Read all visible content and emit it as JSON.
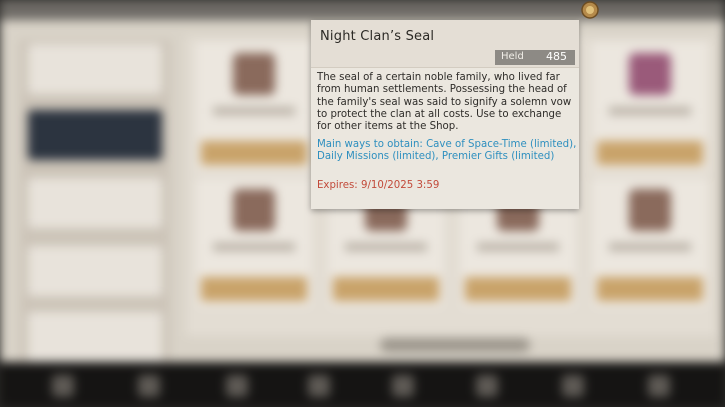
{
  "tooltip": {
    "title": "Night Clan’s Seal",
    "held_label": "Held",
    "held_value": "485",
    "description": "The seal of a certain noble family, who lived far from human settlements. Possessing the head of the family's seal was said to signify a solemn vow to protect the clan at all costs. Use to exchange for other items at the Shop.",
    "obtain": "Main ways to obtain: Cave of Space-Time (limited), Daily Missions (limited), Premier Gifts (limited)",
    "expires": "Expires: 9/10/2025 3:59"
  },
  "colors": {
    "obtain_text": "#2e8fbf",
    "expires_text": "#c24a3a",
    "held_bar": "#8d8a85"
  },
  "icons": {
    "currency": "seal-coin-icon"
  }
}
